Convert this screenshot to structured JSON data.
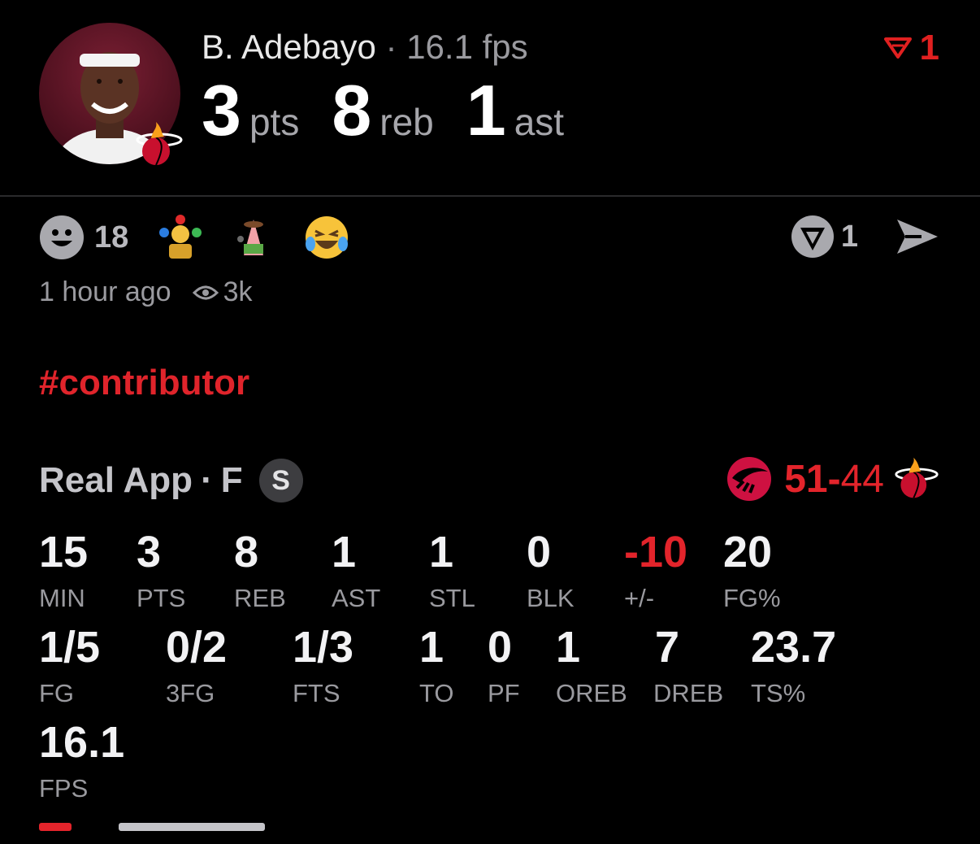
{
  "header": {
    "player_name": "B. Adebayo",
    "separator": "·",
    "fps_label": "16.1 fps",
    "statline": [
      {
        "value": "3",
        "label": "pts"
      },
      {
        "value": "8",
        "label": "reb"
      },
      {
        "value": "1",
        "label": "ast"
      }
    ],
    "vote_count": "1"
  },
  "reactions": {
    "count": "18",
    "emojis": [
      "juggler-emoji",
      "patrick-sticker-emoji",
      "laughing-tears-emoji"
    ],
    "vote_count": "1"
  },
  "meta": {
    "time_ago": "1 hour ago",
    "views": "3k"
  },
  "hashtag": "#contributor",
  "game": {
    "source": "Real App",
    "separator": "·",
    "position": "F",
    "badge": "S",
    "score_home": "51",
    "score_dash": "-",
    "score_away": "44"
  },
  "stats_row1": [
    {
      "value": "15",
      "label": "MIN"
    },
    {
      "value": "3",
      "label": "PTS"
    },
    {
      "value": "8",
      "label": "REB"
    },
    {
      "value": "1",
      "label": "AST"
    },
    {
      "value": "1",
      "label": "STL"
    },
    {
      "value": "0",
      "label": "BLK"
    },
    {
      "value": "-10",
      "label": "+/-"
    },
    {
      "value": "20",
      "label": "FG%"
    }
  ],
  "stats_row2": [
    {
      "value": "1/5",
      "label": "FG"
    },
    {
      "value": "0/2",
      "label": "3FG"
    },
    {
      "value": "1/3",
      "label": "FTS"
    },
    {
      "value": "1",
      "label": "TO"
    },
    {
      "value": "0",
      "label": "PF"
    },
    {
      "value": "1",
      "label": "OREB"
    },
    {
      "value": "7",
      "label": "DREB"
    },
    {
      "value": "23.7",
      "label": "TS%"
    }
  ],
  "stats_row3": [
    {
      "value": "16.1",
      "label": "FPS"
    }
  ],
  "colors": {
    "accent_red": "#e3242b",
    "muted": "#9a9a9f",
    "background": "#000000"
  }
}
